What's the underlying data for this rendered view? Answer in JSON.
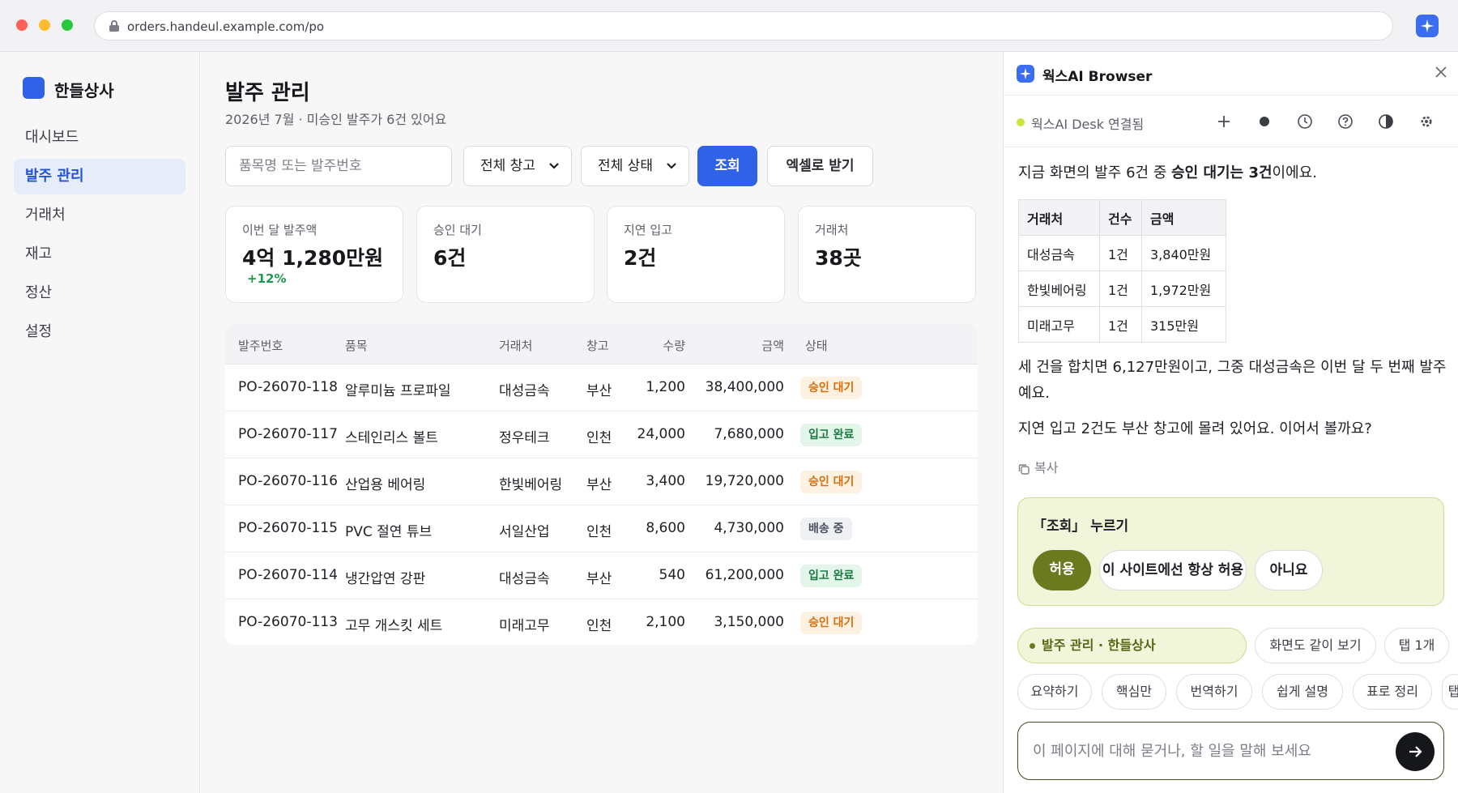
{
  "browser": {
    "url": "orders.handeul.example.com/po"
  },
  "sidebar": {
    "brand": "한들상사",
    "items": [
      {
        "label": "대시보드",
        "active": false
      },
      {
        "label": "발주 관리",
        "active": true
      },
      {
        "label": "거래처",
        "active": false
      },
      {
        "label": "재고",
        "active": false
      },
      {
        "label": "정산",
        "active": false
      },
      {
        "label": "설정",
        "active": false
      }
    ]
  },
  "main": {
    "title": "발주 관리",
    "subtitle": "2026년 7월 · 미승인 발주가 6건 있어요",
    "search_placeholder": "품목명 또는 발주번호",
    "warehouse_select": "전체 창고",
    "status_select": "전체 상태",
    "search_button": "조회",
    "excel_button": "엑셀로 받기",
    "cards": [
      {
        "label": "이번 달 발주액",
        "value": "4억 1,280만원",
        "delta": "+12%"
      },
      {
        "label": "승인 대기",
        "value": "6건"
      },
      {
        "label": "지연 입고",
        "value": "2건"
      },
      {
        "label": "거래처",
        "value": "38곳"
      }
    ],
    "table": {
      "headers": [
        "발주번호",
        "품목",
        "거래처",
        "창고",
        "수량",
        "금액",
        "상태"
      ],
      "rows": [
        {
          "id": "PO-26070-118",
          "item": "알루미늄 프로파일",
          "vendor": "대성금속",
          "warehouse": "부산",
          "qty": "1,200",
          "amount": "38,400,000",
          "status": "승인 대기",
          "status_type": "wait"
        },
        {
          "id": "PO-26070-117",
          "item": "스테인리스 볼트",
          "vendor": "정우테크",
          "warehouse": "인천",
          "qty": "24,000",
          "amount": "7,680,000",
          "status": "입고 완료",
          "status_type": "done"
        },
        {
          "id": "PO-26070-116",
          "item": "산업용 베어링",
          "vendor": "한빛베어링",
          "warehouse": "부산",
          "qty": "3,400",
          "amount": "19,720,000",
          "status": "승인 대기",
          "status_type": "wait"
        },
        {
          "id": "PO-26070-115",
          "item": "PVC 절연 튜브",
          "vendor": "서일산업",
          "warehouse": "인천",
          "qty": "8,600",
          "amount": "4,730,000",
          "status": "배송 중",
          "status_type": "ship"
        },
        {
          "id": "PO-26070-114",
          "item": "냉간압연 강판",
          "vendor": "대성금속",
          "warehouse": "부산",
          "qty": "540",
          "amount": "61,200,000",
          "status": "입고 완료",
          "status_type": "done"
        },
        {
          "id": "PO-26070-113",
          "item": "고무 개스킷 세트",
          "vendor": "미래고무",
          "warehouse": "인천",
          "qty": "2,100",
          "amount": "3,150,000",
          "status": "승인 대기",
          "status_type": "wait"
        }
      ]
    }
  },
  "panel": {
    "title": "웍스AI Browser",
    "connection": "웍스AI Desk 연결됨",
    "msg1_prefix": "지금 화면의 발주 6건 중 ",
    "msg1_bold": "승인 대기는 3건",
    "msg1_suffix": "이에요.",
    "summary_headers": [
      "거래처",
      "건수",
      "금액"
    ],
    "summary_rows": [
      [
        "대성금속",
        "1건",
        "3,840만원"
      ],
      [
        "한빛베어링",
        "1건",
        "1,972만원"
      ],
      [
        "미래고무",
        "1건",
        "315만원"
      ]
    ],
    "msg2": "세 건을 합치면 6,127만원이고, 그중 대성금속은 이번 달 두 번째 발주예요.",
    "msg3": "지연 입고 2건도 부산 창고에 몰려 있어요. 이어서 볼까요?",
    "copy_label": "복사",
    "approval": {
      "title": "「조회」 누르기",
      "allow": "허용",
      "always": "이 사이트에선 항상 허용",
      "deny": "아니요"
    },
    "context_chips": [
      "발주 관리 · 한들상사",
      "화면도 같이 보기",
      "탭 1개"
    ],
    "quick_chips": [
      "요약하기",
      "핵심만",
      "번역하기",
      "쉽게 설명",
      "표로 정리",
      "탭"
    ],
    "composer_placeholder": "이 페이지에 대해 묻거나, 할 일을 말해 보세요"
  },
  "colors": {
    "accent": "#2f62e6",
    "wait": "#d86d0c",
    "done": "#187a42",
    "approve": "#6b7a1e"
  }
}
